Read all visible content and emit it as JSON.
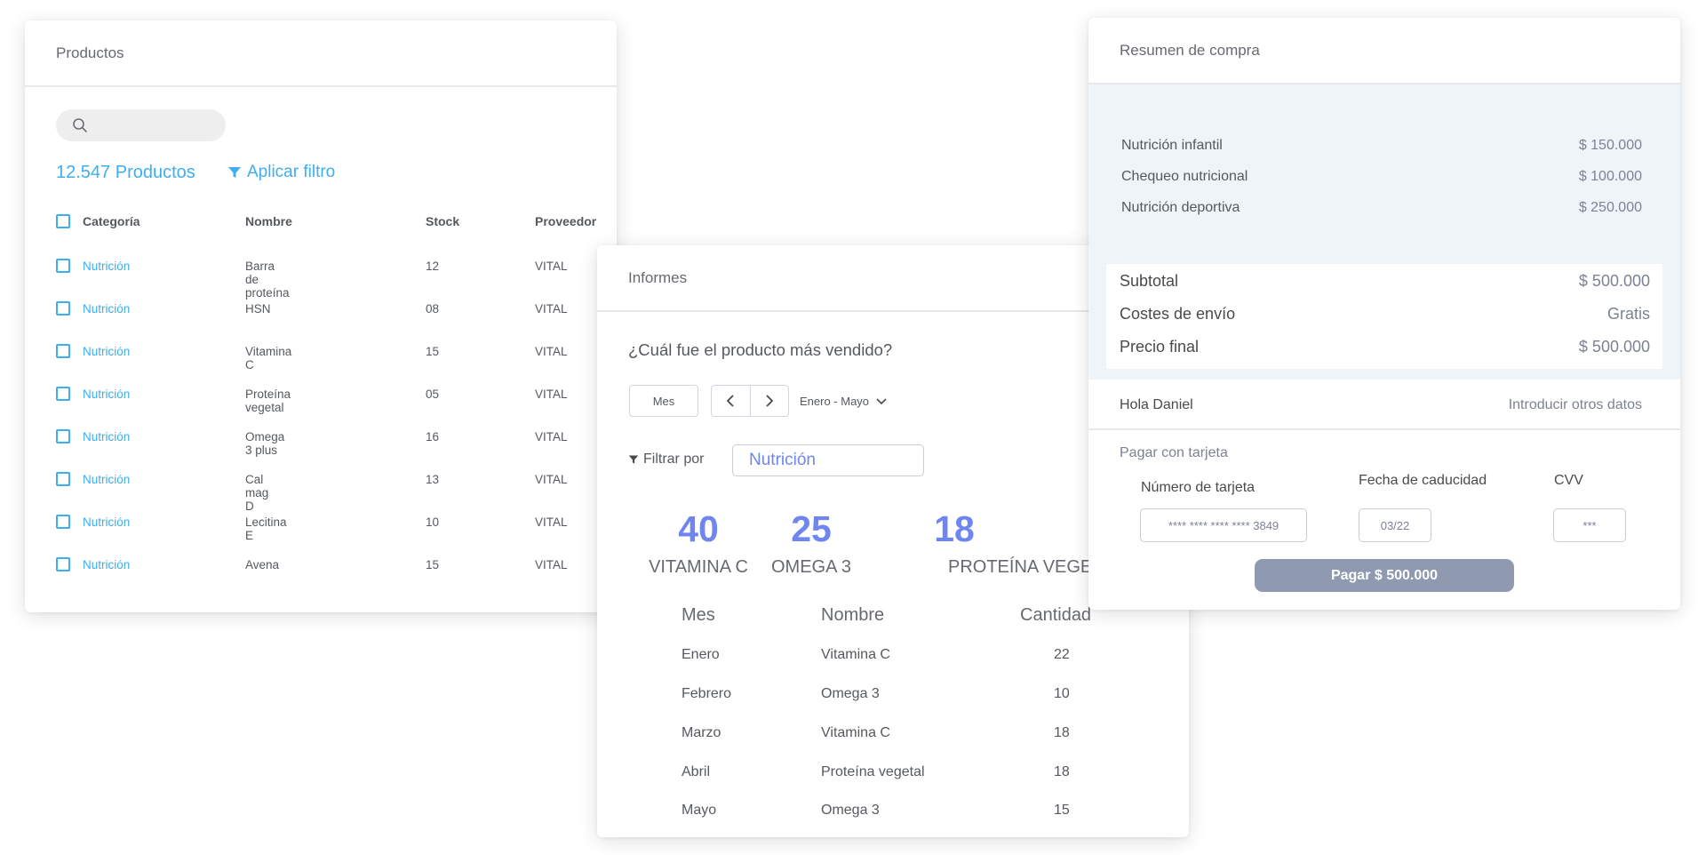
{
  "productos": {
    "title": "Productos",
    "search": {
      "placeholder": ""
    },
    "count": "12.547 Productos",
    "filter_label": "Aplicar filtro",
    "headers": [
      "Categoría",
      "Nombre",
      "Stock",
      "Proveedor"
    ],
    "rows": [
      {
        "categoria": "Nutrición",
        "nombre": "Barra de proteína",
        "stock": "12",
        "proveedor": "VITAL"
      },
      {
        "categoria": "Nutrición",
        "nombre": "HSN",
        "stock": "08",
        "proveedor": "VITAL"
      },
      {
        "categoria": "Nutrición",
        "nombre": "Vitamina C",
        "stock": "15",
        "proveedor": "VITAL"
      },
      {
        "categoria": "Nutrición",
        "nombre": "Proteína vegetal",
        "stock": "05",
        "proveedor": "VITAL"
      },
      {
        "categoria": "Nutrición",
        "nombre": "Omega 3 plus",
        "stock": "16",
        "proveedor": "VITAL"
      },
      {
        "categoria": "Nutrición",
        "nombre": "Cal mag D",
        "stock": "13",
        "proveedor": "VITAL"
      },
      {
        "categoria": "Nutrición",
        "nombre": "Lecitina E",
        "stock": "10",
        "proveedor": "VITAL"
      },
      {
        "categoria": "Nutrición",
        "nombre": "Avena",
        "stock": "15",
        "proveedor": "VITAL"
      }
    ]
  },
  "informes": {
    "title": "Informes",
    "question": "¿Cuál fue el producto más vendido?",
    "period_button": "Mes",
    "range": "Enero - Mayo",
    "filter_label": "Filtrar por",
    "filter_value": "Nutrición",
    "stats": [
      {
        "value": "40",
        "label": "VITAMINA C"
      },
      {
        "value": "25",
        "label": "OMEGA 3"
      },
      {
        "value": "18",
        "label": "PROTEÍNA VEGETAL"
      }
    ],
    "table_headers": [
      "Mes",
      "Nombre",
      "Cantidad"
    ],
    "table_rows": [
      {
        "mes": "Enero",
        "nombre": "Vitamina C",
        "cantidad": "22"
      },
      {
        "mes": "Febrero",
        "nombre": "Omega 3",
        "cantidad": "10"
      },
      {
        "mes": "Marzo",
        "nombre": "Vitamina C",
        "cantidad": "18"
      },
      {
        "mes": "Abril",
        "nombre": "Proteína vegetal",
        "cantidad": "18"
      },
      {
        "mes": "Mayo",
        "nombre": "Omega 3",
        "cantidad": "15"
      }
    ]
  },
  "resumen": {
    "title": "Resumen de compra",
    "items": [
      {
        "label": "Nutrición infantil",
        "value": "$ 150.000"
      },
      {
        "label": "Chequeo nutricional",
        "value": "$ 100.000"
      },
      {
        "label": "Nutrición deportiva",
        "value": "$ 250.000"
      }
    ],
    "subtotal_label": "Subtotal",
    "subtotal_value": "$ 500.000",
    "shipping_label": "Costes de envío",
    "shipping_value": "Gratis",
    "final_label": "Precio final",
    "final_value": "$ 500.000",
    "greeting": "Hola Daniel",
    "other_data_link": "Introducir otros datos",
    "pay_with_card": "Pagar con tarjeta",
    "card_number_label": "Número de tarjeta",
    "card_number_value": "**** **** **** **** 3849",
    "expiry_label": "Fecha de caducidad",
    "expiry_value": "03/22",
    "cvv_label": "CVV",
    "cvv_value": "***",
    "pay_button": "Pagar $ 500.000"
  },
  "colors": {
    "accent_blue": "#3eaef0",
    "accent_purple": "#6f86f0",
    "pay_button": "#8f9ab0",
    "summary_bg": "#eff4f9"
  }
}
